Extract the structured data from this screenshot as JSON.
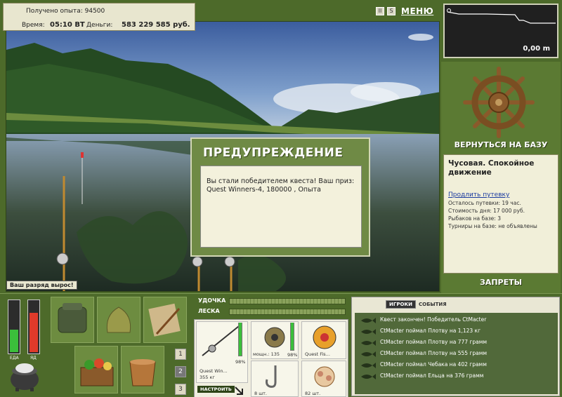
{
  "info": {
    "exp_label": "Получено опыта:",
    "exp_value": "94500",
    "time_label": "Время:",
    "time_value": "05:10 ВТ",
    "money_label": "Деньги:",
    "money_value": "583 229 585 руб."
  },
  "top_icons": {
    "pause": "II",
    "settings": "S",
    "menu": "МЕНЮ"
  },
  "depth": {
    "value": "0,00 m"
  },
  "base": {
    "return_label": "ВЕРНУТЬСЯ НА БАЗУ",
    "location": "Чусовая. Спокойное движение",
    "extend_link": "Продлить путевку",
    "lines": [
      "Осталось путевки: 19 час.",
      "Стоимость дня: 17 000 руб.",
      "Рыбаков на базе: 3",
      "Турниры на базе: не объявлены"
    ],
    "bans_label": "ЗАПРЕТЫ"
  },
  "modal": {
    "title": "ПРЕДУПРЕЖДЕНИЕ",
    "message": "Вы стали победителем квеста! Ваш приз: Quest Winners-4, 180000 , Опыта"
  },
  "rank_toast": "Ваш разряд вырос!",
  "meters": {
    "food_label": "ЕДА",
    "poison_label": "ЯД",
    "food_level": 0.45,
    "poison_level": 0.75
  },
  "slots": [
    "1",
    "2",
    "3"
  ],
  "bars": {
    "rod_label": "УДОЧКА",
    "line_label": "ЛЕСКА"
  },
  "tackle": {
    "rod_name": "Quest Win...",
    "rod_weight": "355 кг",
    "rod_pct": "98%",
    "rod_pct_level": 0.98,
    "reel_caption": "мощн.: 135",
    "reel_pct": "98%",
    "reel_pct_level": 0.98,
    "line_caption": "Quest Fis...",
    "hook_caption": "8 шт.",
    "bait_caption": "82 шт.",
    "setup_label": "НАСТРОИТЬ"
  },
  "events": {
    "tab_players": "ИГРОКИ",
    "tab_events": "СОБЫТИЯ",
    "items": [
      "Квест закончен! Победитель CtMacter",
      "CtMacter поймал Плотву на 1,123 кг",
      "CtMacter поймал Плотву на 777 грамм",
      "CtMacter поймал Плотву на 555 грамм",
      "CtMacter поймал Чебака на 402 грамм",
      "CtMacter поймал Ельца на 376 грамм"
    ]
  },
  "colors": {
    "frame_green": "#4d6a2a",
    "panel_cream": "#f1efd9",
    "link_blue": "#1a3aa0"
  }
}
